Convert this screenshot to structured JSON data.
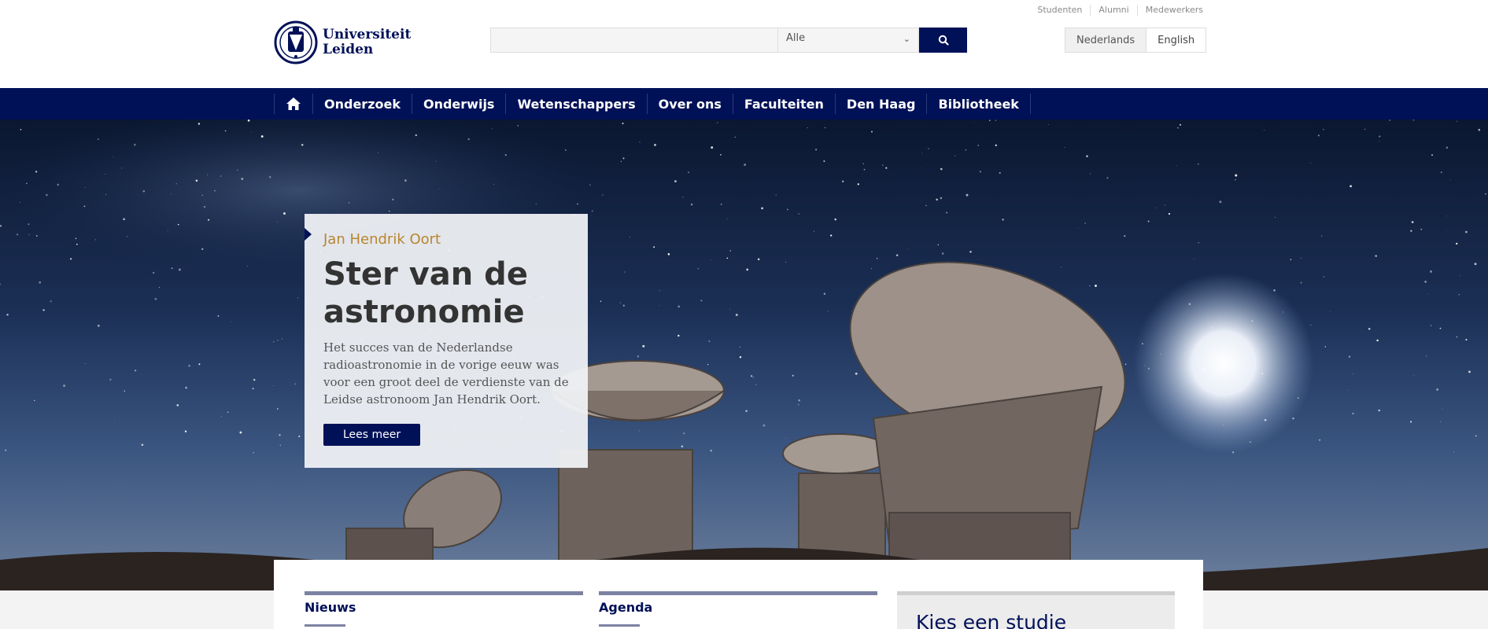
{
  "top_links": [
    "Studenten",
    "Alumni",
    "Medewerkers"
  ],
  "logo": {
    "line1": "Universiteit",
    "line2": "Leiden"
  },
  "search": {
    "placeholder": "",
    "filter_value": "Alle"
  },
  "languages": [
    {
      "label": "Nederlands",
      "active": true
    },
    {
      "label": "English",
      "active": false
    }
  ],
  "nav": {
    "home_icon": "home-icon",
    "items": [
      "Onderzoek",
      "Onderwijs",
      "Wetenschappers",
      "Over ons",
      "Faculteiten",
      "Den Haag",
      "Bibliotheek"
    ]
  },
  "hero": {
    "kicker": "Jan Hendrik Oort",
    "title": "Ster van de astronomie",
    "description": "Het succes van de Nederlandse radioastronomie in de vorige eeuw was voor een groot deel de verdienste van de Leidse astronoom Jan Hendrik Oort.",
    "button_label": "Lees meer"
  },
  "sections": {
    "news_title": "Nieuws",
    "agenda_title": "Agenda",
    "study_title": "Kies een studie"
  },
  "colors": {
    "brand": "#001158",
    "accent": "#b8862f"
  }
}
